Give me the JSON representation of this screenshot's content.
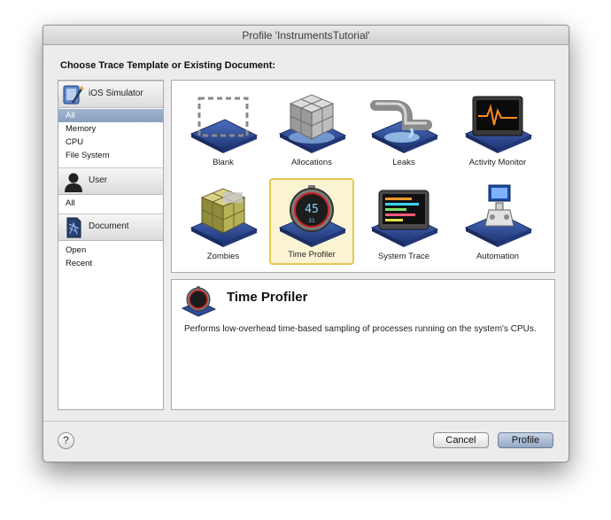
{
  "window": {
    "title": "Profile 'InstrumentsTutorial'"
  },
  "heading": "Choose Trace Template or Existing Document:",
  "sidebar": {
    "groups": [
      {
        "label": "iOS Simulator",
        "icon": "ios-simulator-icon",
        "items": [
          "All",
          "Memory",
          "CPU",
          "File System"
        ],
        "selected": "All"
      },
      {
        "label": "User",
        "icon": "user-silhouette-icon",
        "items": [
          "All"
        ]
      },
      {
        "label": "Document",
        "icon": "document-icon",
        "items": [
          "Open",
          "Recent"
        ]
      }
    ]
  },
  "templates": [
    {
      "label": "Blank",
      "icon": "blank-template-icon"
    },
    {
      "label": "Allocations",
      "icon": "allocations-cube-icon"
    },
    {
      "label": "Leaks",
      "icon": "leaks-pipe-icon"
    },
    {
      "label": "Activity Monitor",
      "icon": "activity-monitor-icon"
    },
    {
      "label": "Zombies",
      "icon": "zombies-cube-icon"
    },
    {
      "label": "Time Profiler",
      "icon": "time-profiler-stopwatch-icon",
      "selected": true,
      "stopwatch_digits": "45",
      "stopwatch_sub": "31"
    },
    {
      "label": "System Trace",
      "icon": "system-trace-icon"
    },
    {
      "label": "Automation",
      "icon": "automation-icon"
    }
  ],
  "description": {
    "title": "Time Profiler",
    "text": "Performs low-overhead time-based sampling of processes running on the system's CPUs."
  },
  "footer": {
    "help_label": "?",
    "cancel_label": "Cancel",
    "profile_label": "Profile"
  },
  "colors": {
    "selection": "#8aa0be",
    "tile_highlight": "#e5c94e",
    "platform_blue": "#2d4f9a"
  }
}
